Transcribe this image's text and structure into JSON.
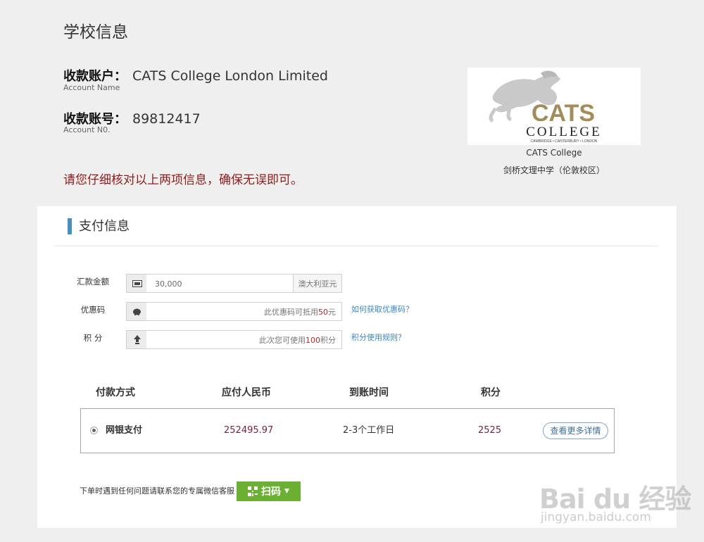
{
  "school": {
    "title": "学校信息",
    "account_name_label": "收款账户：",
    "account_name": "CATS College London Limited",
    "account_name_en": "Account Name",
    "account_no_label": "收款账号：",
    "account_no": "89812417",
    "account_no_en": "Account N0.",
    "notice": "请您仔细核对以上两项信息，确保无误即可。",
    "logo_word1": "CATS",
    "logo_word2": "COLLEGE",
    "logo_tagline": "CAMBRIDGE • CANTERBURY • LONDON",
    "caption_en": "CATS College",
    "caption_cn": "剑桥文理中学（伦敦校区）",
    "logo_color": "#a38c5b"
  },
  "payment": {
    "section_title": "支付信息",
    "accent_color": "#4a8fc2",
    "fields": {
      "amount": {
        "label": "汇款金额",
        "value": "30,000",
        "unit": "澳大利亚元"
      },
      "coupon": {
        "label": "优惠码",
        "hint_pre": "此优惠码可抵用",
        "hint_num": "50",
        "hint_post": "元",
        "link": "如何获取优惠码？"
      },
      "points": {
        "label": "积  分",
        "hint_pre": "此次您可使用",
        "hint_num": "100",
        "hint_post": "积分",
        "link": "积分使用规则？"
      }
    },
    "table": {
      "headers": [
        "付款方式",
        "应付人民币",
        "到账时间",
        "积分"
      ],
      "row": {
        "method": "网银支付",
        "amount_rmb": "252495.97",
        "arrival": "2-3个工作日",
        "points": "2525",
        "detail_button": "查看更多详情"
      }
    },
    "contact_text": "下单时遇到任何问题请联系您的专属微信客服",
    "scan_button": "扫码",
    "scan_color": "#6bb032"
  },
  "watermark": {
    "logo": "Bai du 经验",
    "url": "jingyan.baidu.com"
  }
}
